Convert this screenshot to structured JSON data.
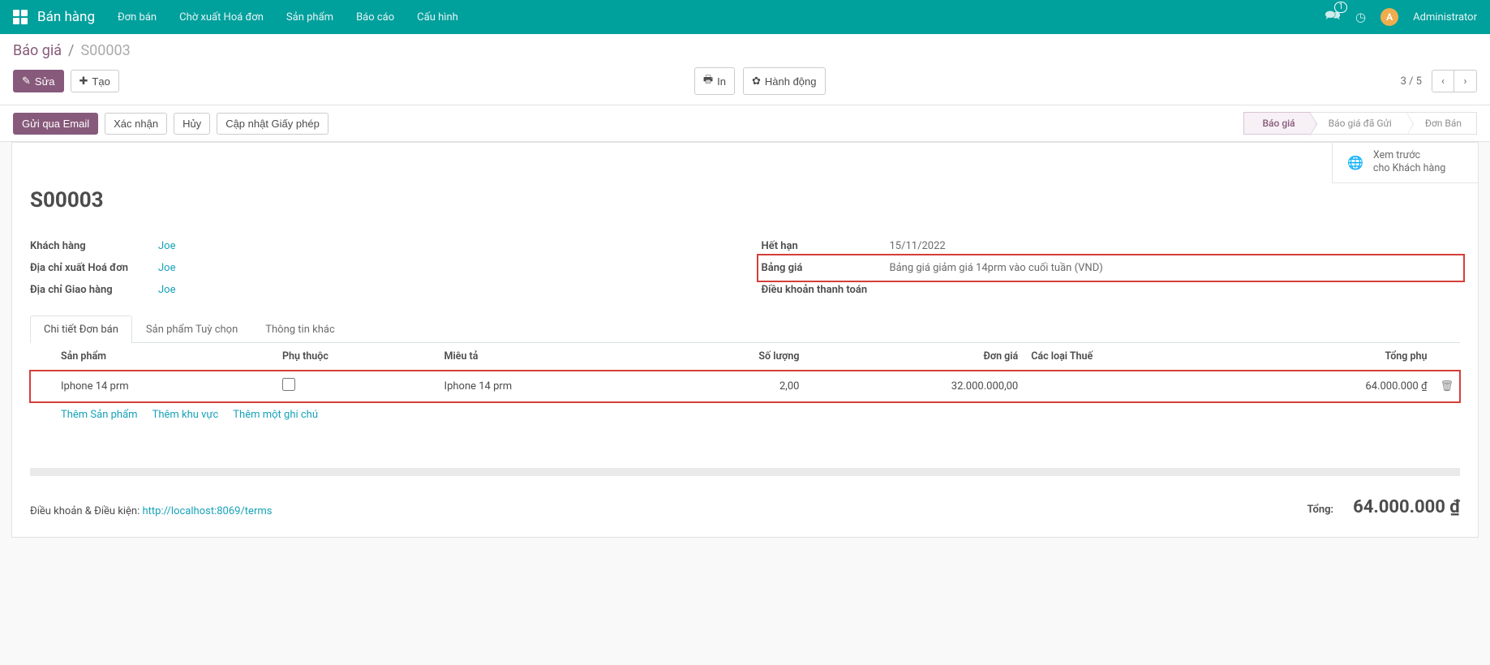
{
  "nav": {
    "brand": "Bán hàng",
    "menu": [
      "Đơn bán",
      "Chờ xuất Hoá đơn",
      "Sản phẩm",
      "Báo cáo",
      "Cấu hình"
    ],
    "chat_badge": "1",
    "avatar_letter": "A",
    "username": "Administrator"
  },
  "breadcrumb": {
    "root": "Báo giá",
    "current": "S00003"
  },
  "toolbar": {
    "edit": "Sửa",
    "create": "Tạo",
    "print": "In",
    "action": "Hành động",
    "pager": "3 / 5"
  },
  "status_actions": {
    "send_email": "Gửi qua Email",
    "confirm": "Xác nhận",
    "cancel": "Hủy",
    "update_license": "Cập nhật Giấy phép"
  },
  "stages": [
    {
      "label": "Báo giá",
      "active": true
    },
    {
      "label": "Báo giá đã Gửi",
      "active": false
    },
    {
      "label": "Đơn Bán",
      "active": false
    }
  ],
  "preview": {
    "line1": "Xem trước",
    "line2": "cho Khách hàng"
  },
  "record": {
    "title": "S00003",
    "left": {
      "customer_label": "Khách hàng",
      "customer_value": "Joe",
      "invoice_addr_label": "Địa chỉ xuất Hoá đơn",
      "invoice_addr_value": "Joe",
      "delivery_addr_label": "Địa chỉ Giao hàng",
      "delivery_addr_value": "Joe"
    },
    "right": {
      "expiry_label": "Hết hạn",
      "expiry_value": "15/11/2022",
      "pricelist_label": "Bảng giá",
      "pricelist_value": "Bảng giá giảm giá 14prm vào cuối tuần (VND)",
      "payment_terms_label": "Điều khoản thanh toán",
      "payment_terms_value": ""
    }
  },
  "tabs": [
    "Chi tiết Đơn bán",
    "Sản phẩm Tuỳ chọn",
    "Thông tin khác"
  ],
  "table": {
    "headers": {
      "product": "Sản phẩm",
      "dependent": "Phụ thuộc",
      "desc": "Miêu tả",
      "qty": "Số lượng",
      "unit_price": "Đơn giá",
      "taxes": "Các loại Thuế",
      "subtotal": "Tổng phụ"
    },
    "rows": [
      {
        "product": "Iphone 14 prm",
        "dependent": false,
        "desc": "Iphone 14 prm",
        "qty": "2,00",
        "unit_price": "32.000.000,00",
        "taxes": "",
        "subtotal": "64.000.000 ₫"
      }
    ],
    "add_product": "Thêm Sản phẩm",
    "add_section": "Thêm khu vực",
    "add_note": "Thêm một ghi chú"
  },
  "footer": {
    "terms_label": "Điều khoản & Điều kiện:",
    "terms_link": "http://localhost:8069/terms",
    "total_label": "Tổng:",
    "total_value": "64.000.000 ₫"
  }
}
